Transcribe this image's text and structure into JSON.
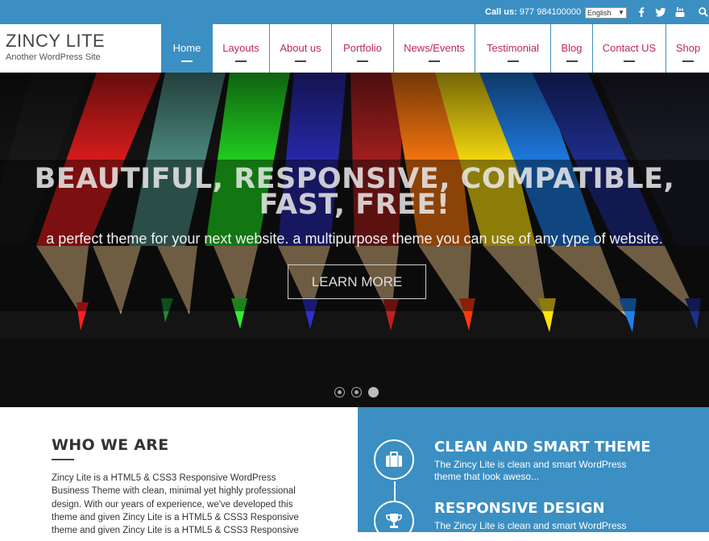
{
  "topbar": {
    "call_label": "Call us:",
    "call_number": "977 984100000",
    "language": "English",
    "social": [
      "facebook-icon",
      "twitter-icon",
      "youtube-icon",
      "search-icon"
    ]
  },
  "site": {
    "title": "ZINCY LITE",
    "tagline": "Another WordPress Site"
  },
  "nav": {
    "items": [
      {
        "label": "Home",
        "active": true
      },
      {
        "label": "Layouts"
      },
      {
        "label": "About us"
      },
      {
        "label": "Portfolio"
      },
      {
        "label": "News/Events"
      },
      {
        "label": "Testimonial"
      },
      {
        "label": "Blog"
      },
      {
        "label": "Contact US"
      },
      {
        "label": "Shop"
      }
    ]
  },
  "hero": {
    "headline_1": "BEAUTIFUL, RESPONSIVE, COMPATIBLE,",
    "headline_2": "FAST, FREE!",
    "subtitle": "a perfect theme for your next website. a multipurpose theme you can use of any type of website.",
    "button": "LEARN MORE",
    "slides": 3,
    "active_slide": 3
  },
  "who": {
    "heading": "WHO WE ARE",
    "text": "Zincy Lite is a HTML5 & CSS3 Responsive WordPress Business Theme with clean, minimal yet highly professional design. With our years of experience, we've developed this theme and given Zincy Lite is a HTML5 & CSS3 Responsive theme and given Zincy Lite is a HTML5 & CSS3 Responsive"
  },
  "features": [
    {
      "title": "CLEAN AND SMART THEME",
      "text": "The Zincy Lite is clean and smart WordPress theme that look aweso...",
      "icon": "briefcase-icon"
    },
    {
      "title": "RESPONSIVE DESIGN",
      "text": "The Zincy Lite is clean and smart WordPress",
      "icon": "trophy-icon"
    }
  ],
  "colors": {
    "accent": "#3b8fc2",
    "nav_text": "#c0265e"
  }
}
